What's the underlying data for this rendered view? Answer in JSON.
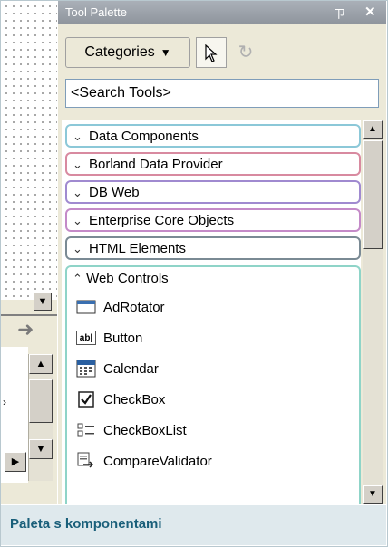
{
  "palette": {
    "title": "Tool Palette",
    "pin_glyph": "ㄗ",
    "close_glyph": "✕",
    "categories_label": "Categories",
    "search_placeholder": "<Search Tools>"
  },
  "categories": [
    {
      "label": "Data Components",
      "color": "#8cc8d8"
    },
    {
      "label": "Borland Data Provider",
      "color": "#d88aa0"
    },
    {
      "label": "DB Web",
      "color": "#a08ad0"
    },
    {
      "label": "Enterprise Core Objects",
      "color": "#c48ac8"
    },
    {
      "label": "HTML Elements",
      "color": "#7a8a94"
    }
  ],
  "expanded_category": {
    "label": "Web Controls",
    "color": "#8fd4c8",
    "items": [
      {
        "label": "AdRotator",
        "icon": "adrotator-icon"
      },
      {
        "label": "Button",
        "icon": "button-icon"
      },
      {
        "label": "Calendar",
        "icon": "calendar-icon"
      },
      {
        "label": "CheckBox",
        "icon": "checkbox-icon"
      },
      {
        "label": "CheckBoxList",
        "icon": "checkboxlist-icon"
      },
      {
        "label": "CompareValidator",
        "icon": "comparevalidator-icon"
      }
    ]
  },
  "caption": "Paleta s komponentami"
}
